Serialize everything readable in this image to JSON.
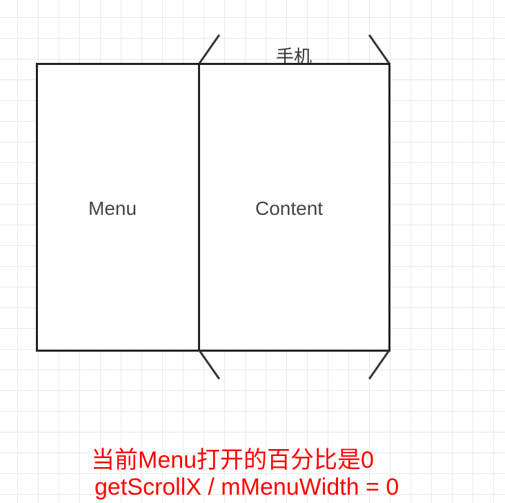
{
  "phone_label": "手机",
  "menu_label": "Menu",
  "content_label": "Content",
  "caption_line1": "当前Menu打开的百分比是0",
  "caption_line2": "getScrollX / mMenuWidth = 0"
}
